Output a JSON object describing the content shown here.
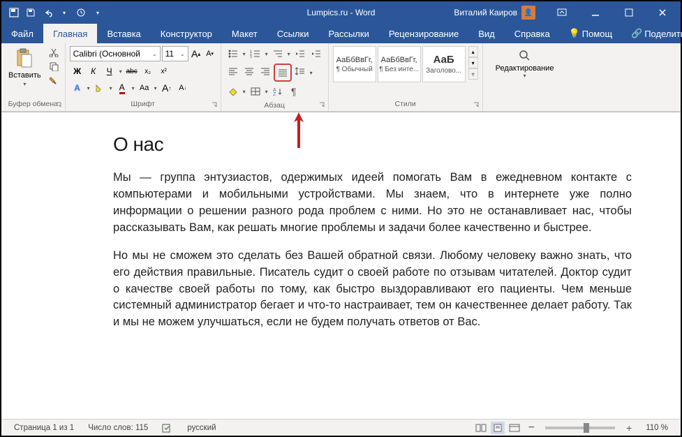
{
  "titlebar": {
    "title": "Lumpics.ru  -  Word",
    "user": "Виталий Каиров"
  },
  "tabs": {
    "file": "Файл",
    "home": "Главная",
    "insert": "Вставка",
    "design": "Конструктор",
    "layout": "Макет",
    "references": "Ссылки",
    "mailings": "Рассылки",
    "review": "Рецензирование",
    "view": "Вид",
    "help": "Справка",
    "tell_me": "Помощ",
    "share": "Поделиться"
  },
  "ribbon": {
    "clipboard": {
      "paste": "Вставить",
      "label": "Буфер обмена"
    },
    "font": {
      "name": "Calibri (Основной",
      "size": "11",
      "label": "Шрифт",
      "bold": "Ж",
      "italic": "К",
      "underline": "Ч",
      "strike": "abc",
      "sub": "x₂",
      "sup": "x²",
      "a1": "A",
      "highlight": "✎",
      "color": "A",
      "case": "Aa",
      "grow": "A",
      "shrink": "A"
    },
    "paragraph": {
      "label": "Абзац"
    },
    "styles": {
      "label": "Стили",
      "s1_sample": "АаБбВвГг,",
      "s1_name": "¶ Обычный",
      "s2_sample": "АаБбВвГг,",
      "s2_name": "¶ Без инте...",
      "s3_sample": "АаБ",
      "s3_name": "Заголово..."
    },
    "editing": {
      "label": "Редактирование"
    }
  },
  "document": {
    "heading": "О нас",
    "p1": "Мы — группа энтузиастов, одержимых идеей помогать Вам в ежедневном контакте с компьютерами и мобильными устройствами. Мы знаем, что в интернете уже полно информации о решении разного рода проблем с ними. Но это не останавливает нас, чтобы рассказывать Вам, как решать многие проблемы и задачи более качественно и быстрее.",
    "p2": "Но мы не сможем это сделать без Вашей обратной связи. Любому человеку важно знать, что его действия правильные. Писатель судит о своей работе по отзывам читателей. Доктор судит о качестве своей работы по тому, как быстро выздоравливают его пациенты. Чем меньше системный администратор бегает и что-то настраивает, тем он качественнее делает работу. Так и мы не можем улучшаться, если не будем получать ответов от Вас."
  },
  "statusbar": {
    "page": "Страница 1 из 1",
    "words": "Число слов: 115",
    "lang": "русский",
    "zoom": "110 %"
  }
}
